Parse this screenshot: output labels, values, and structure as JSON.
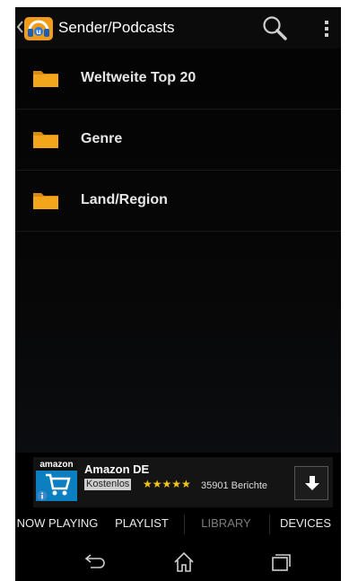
{
  "action_bar": {
    "title": "Sender/Podcasts"
  },
  "list": {
    "items": [
      {
        "label": "Weltweite Top 20"
      },
      {
        "label": "Genre"
      },
      {
        "label": "Land/Region"
      }
    ]
  },
  "ad": {
    "brand": "amazon",
    "title": "Amazon DE",
    "badge": "Kostenlos",
    "stars": "★★★★★",
    "rating": 4.5,
    "reviews": "35901 Berichte"
  },
  "tabs": [
    {
      "label": "NOW PLAYING"
    },
    {
      "label": "PLAYLIST"
    },
    {
      "label": "LIBRARY"
    },
    {
      "label": "DEVICES"
    }
  ],
  "colors": {
    "folder": "#f2a61c",
    "active_tab": "#7d7d7d",
    "star": "#f5c518"
  }
}
